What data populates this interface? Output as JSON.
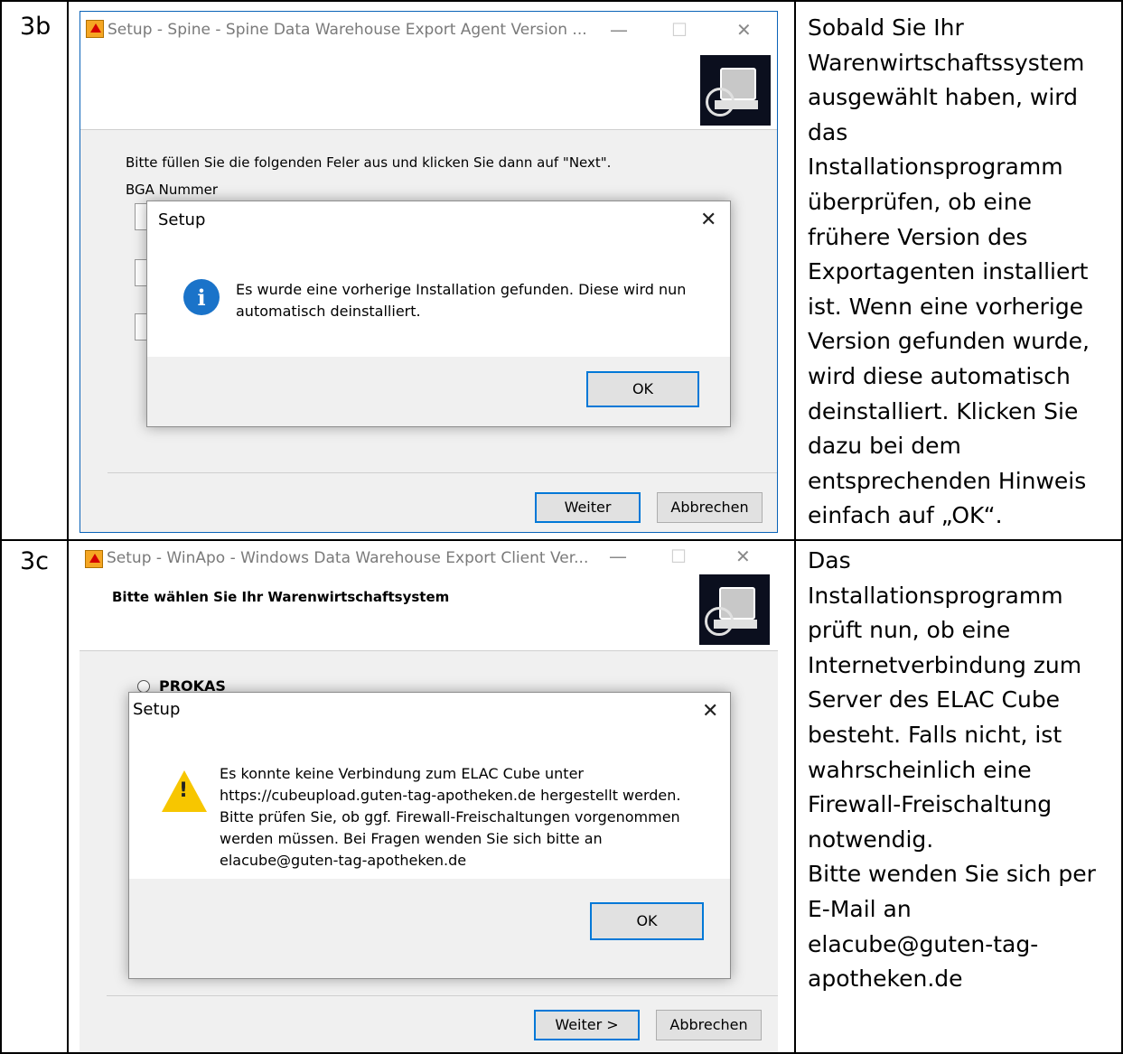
{
  "rows": [
    {
      "step": "3b",
      "window": {
        "title": "Setup - Spine - Spine Data Warehouse Export Agent Version ...",
        "minimize_icon": "minimize-icon",
        "maximize_icon": "maximize-icon",
        "close_icon": "close-icon",
        "instruction": "Bitte füllen Sie die folgenden Feler aus und klicken Sie dann auf \"Next\".",
        "field1_label": "BGA Nummer",
        "buttons": {
          "next": "Weiter",
          "cancel": "Abbrechen"
        }
      },
      "dialog": {
        "title": "Setup",
        "icon": "info-icon",
        "message": "Es wurde eine vorherige Installation gefunden. Diese wird nun\nautomatisch deinstalliert.",
        "ok": "OK"
      },
      "description": "Sobald Sie Ihr\nWarenwirtschaftssystem\nausgewählt haben, wird\ndas\nInstallationsprogramm\nüberprüfen, ob eine\nfrühere Version des\nExportagenten installiert\nist. Wenn eine vorherige\nVersion gefunden wurde,\nwird diese automatisch\ndeinstalliert. Klicken Sie\ndazu bei dem\nentsprechenden Hinweis\neinfach auf „OK“."
    },
    {
      "step": "3c",
      "window": {
        "title": "Setup - WinApo - Windows Data Warehouse Export Client Ver...",
        "header": "Bitte wählen Sie Ihr Warenwirtschaftsystem",
        "option": "PROKAS",
        "buttons": {
          "next": "Weiter >",
          "cancel": "Abbrechen"
        }
      },
      "dialog": {
        "title": "Setup",
        "icon": "warning-icon",
        "message": "Es konnte keine Verbindung zum ELAC Cube unter\nhttps://cubeupload.guten-tag-apotheken.de hergestellt werden.\nBitte prüfen Sie, ob ggf. Firewall-Freischaltungen vorgenommen\nwerden müssen. Bei Fragen wenden Sie sich bitte an\nelacube@guten-tag-apotheken.de",
        "ok": "OK"
      },
      "description": "Das\nInstallationsprogramm\nprüft nun, ob eine\nInternetverbindung zum\nServer des ELAC Cube\nbesteht. Falls nicht, ist\nwahrscheinlich eine\nFirewall-Freischaltung\nnotwendig.\nBitte wenden Sie sich per\nE-Mail an\nelacube@guten-tag-\napotheken.de"
    }
  ],
  "glyphs": {
    "minimize": "—",
    "maximize": "☐",
    "close": "✕",
    "info": "i",
    "warning": "!"
  }
}
